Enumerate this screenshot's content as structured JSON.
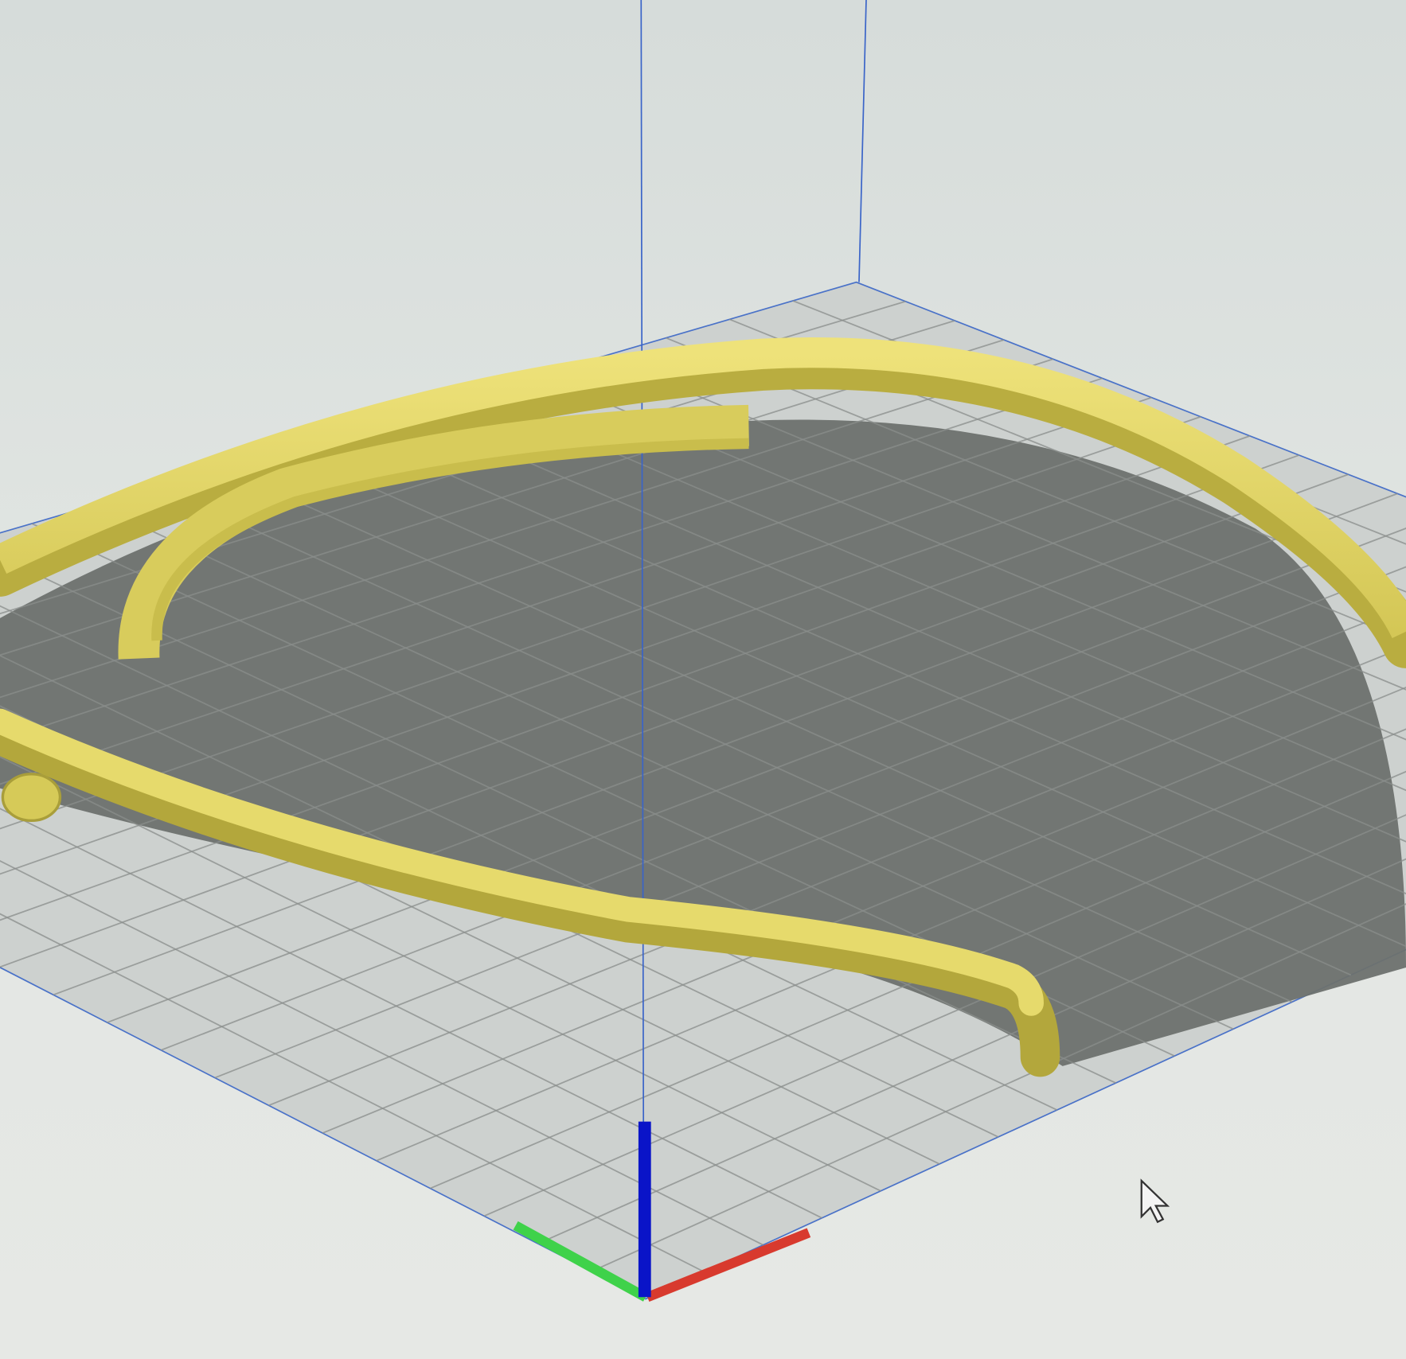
{
  "viewport": {
    "view": "3d-build-plate",
    "colors": {
      "background": "#dfe4e1",
      "plate": "#cfd3d1",
      "grid_line": "#8a8e8c",
      "shadow": "#6b6f6c",
      "model": "#e3d86a",
      "model_dark": "#b7ac3f",
      "axis_x": "#d83a2e",
      "axis_y": "#3fd24a",
      "axis_z": "#0a14c8",
      "bounds_line": "#3a64c8"
    },
    "grid_divisions": 22
  }
}
